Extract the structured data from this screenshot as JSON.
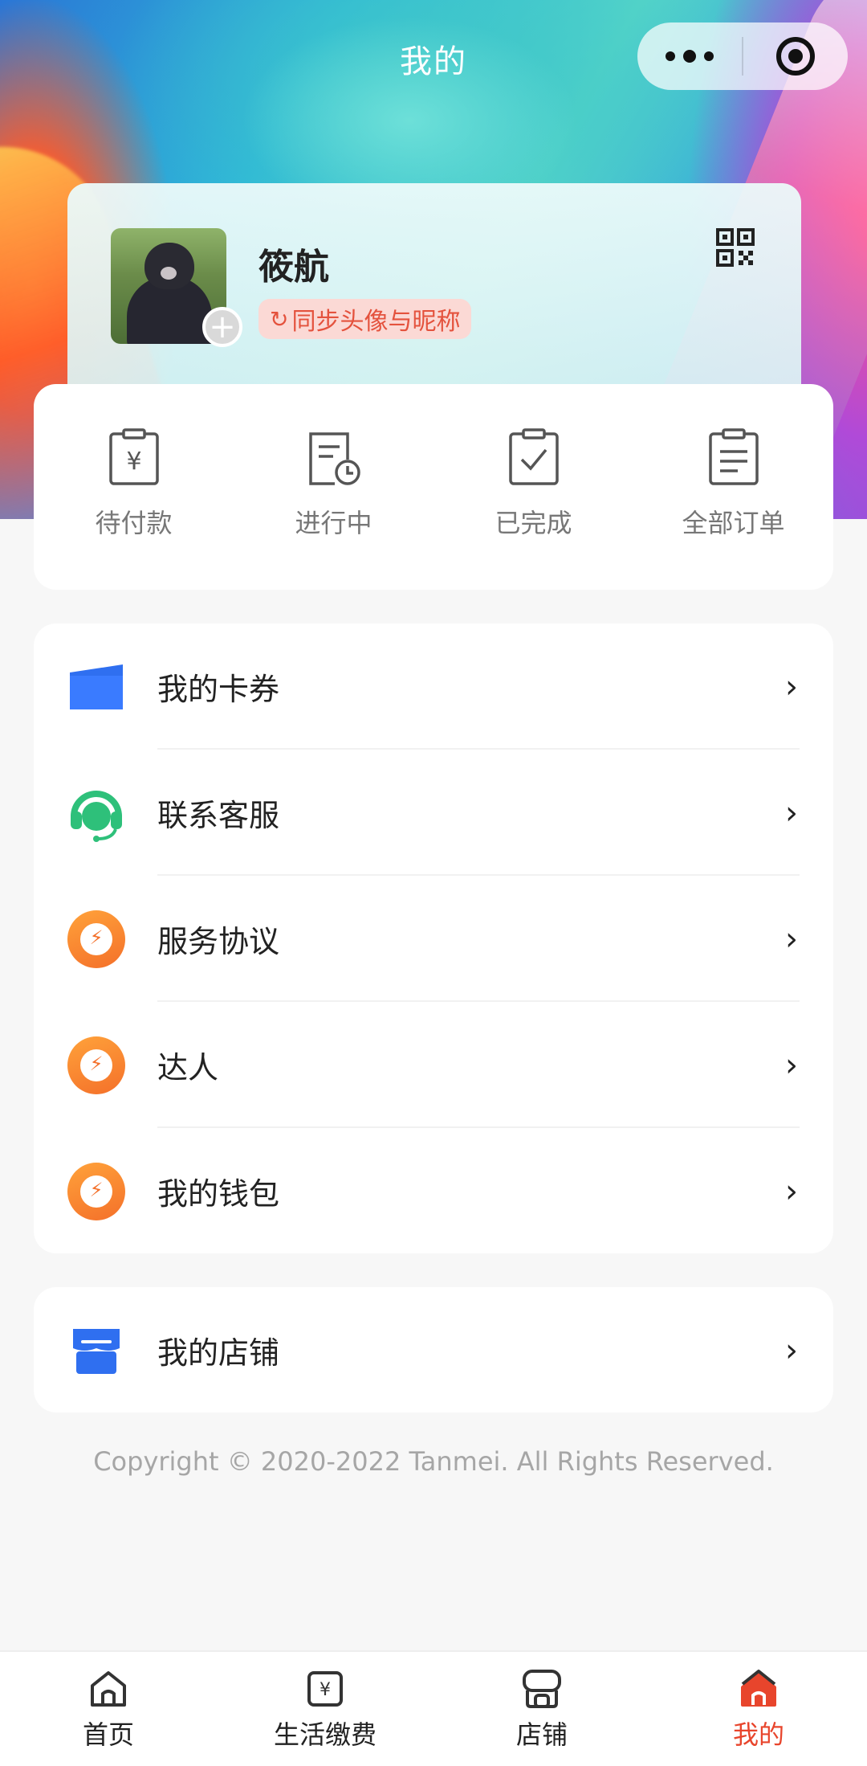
{
  "header": {
    "title": "我的"
  },
  "capsule": {
    "more_icon": "more-dots-icon",
    "close_icon": "target-circle-icon"
  },
  "profile": {
    "nickname": "筱航",
    "sync_label": "同步头像与昵称",
    "sync_icon": "↻",
    "add_avatar_glyph": "+"
  },
  "orders": [
    {
      "label": "待付款",
      "icon": "pending-payment-icon"
    },
    {
      "label": "进行中",
      "icon": "in-progress-icon"
    },
    {
      "label": "已完成",
      "icon": "completed-icon"
    },
    {
      "label": "全部订单",
      "icon": "all-orders-icon"
    }
  ],
  "menu": [
    {
      "label": "我的卡券",
      "icon": "card-voucher-icon"
    },
    {
      "label": "联系客服",
      "icon": "customer-service-icon"
    },
    {
      "label": "服务协议",
      "icon": "agreement-icon"
    },
    {
      "label": "达人",
      "icon": "expert-icon"
    },
    {
      "label": "我的钱包",
      "icon": "wallet-icon"
    }
  ],
  "store": {
    "label": "我的店铺",
    "icon": "store-icon"
  },
  "chevron": "›",
  "copyright": "Copyright © 2020-2022 Tanmei. All Rights Reserved.",
  "tabs": [
    {
      "label": "首页",
      "icon": "home-icon",
      "active": false
    },
    {
      "label": "生活缴费",
      "icon": "payment-icon",
      "active": false
    },
    {
      "label": "店铺",
      "icon": "shop-icon",
      "active": false
    },
    {
      "label": "我的",
      "icon": "profile-icon",
      "active": true
    }
  ],
  "colors": {
    "accent": "#e8452c",
    "blue": "#2f6ff0",
    "green": "#2ec07a",
    "orange": "#f4702a"
  }
}
